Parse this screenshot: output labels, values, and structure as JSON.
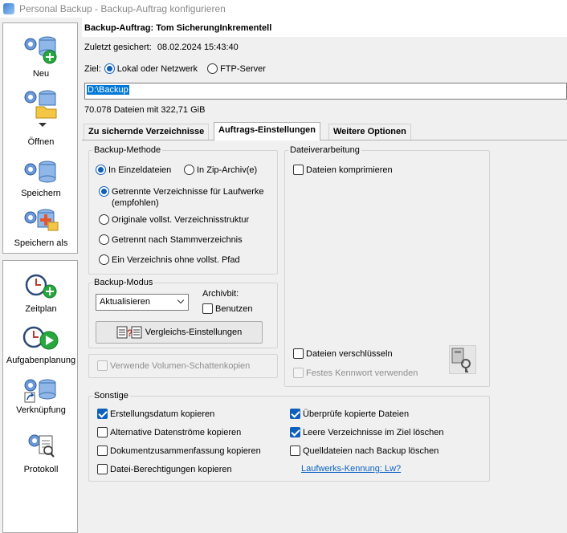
{
  "window": {
    "title": "Personal Backup - Backup-Auftrag konfigurieren"
  },
  "sidebar": {
    "top_items": [
      {
        "label": "Neu",
        "icon": "gears-database-plus-icon"
      },
      {
        "label": "Öffnen",
        "icon": "gears-database-folder-icon"
      },
      {
        "label": "Speichern",
        "icon": "gears-database-icon"
      },
      {
        "label": "Speichern als",
        "icon": "gears-database-save-as-icon"
      }
    ],
    "bottom_items": [
      {
        "label": "Zeitplan",
        "icon": "clock-plus-icon"
      },
      {
        "label": "Aufgabenplanung",
        "icon": "clock-play-icon"
      },
      {
        "label": "Verknüpfung",
        "icon": "shortcut-database-icon"
      },
      {
        "label": "Protokoll",
        "icon": "gear-document-icon"
      }
    ]
  },
  "header": {
    "title": "Backup-Auftrag: Tom SicherungInkrementell",
    "saved_label": "Zuletzt gesichert:",
    "saved_value": "08.02.2024 15:43:40"
  },
  "target": {
    "label": "Ziel:",
    "options": [
      "Lokal oder Netzwerk",
      "FTP-Server"
    ],
    "selected": "Lokal oder Netzwerk",
    "path": "D:\\Backup",
    "file_count": "70.078 Dateien mit 322,71 GiB"
  },
  "tabs": [
    "Zu sichernde Verzeichnisse",
    "Auftrags-Einstellungen",
    "Weitere Optionen"
  ],
  "active_tab": "Auftrags-Einstellungen",
  "backup_method": {
    "legend": "Backup-Methode",
    "mode_options": [
      "In Einzeldateien",
      "In Zip-Archiv(e)"
    ],
    "mode_selected": "In Einzeldateien",
    "structure_options": [
      "Getrennte Verzeichnisse für Laufwerke",
      "Originale vollst. Verzeichnisstruktur",
      "Getrennt nach Stammverzeichnis",
      "Ein Verzeichnis ohne vollst. Pfad"
    ],
    "structure_note": "(empfohlen)",
    "structure_selected": "Getrennte Verzeichnisse für Laufwerke"
  },
  "backup_mode": {
    "legend": "Backup-Modus",
    "select_value": "Aktualisieren",
    "archive_bit_label": "Archivbit:",
    "archive_bit_checkbox": "Benutzen",
    "archive_bit_checked": false,
    "compare_button": "Vergleichs-Einstellungen"
  },
  "shadow_copy": {
    "label": "Verwende Volumen-Schattenkopien",
    "checked": false,
    "enabled": false
  },
  "file_processing": {
    "legend": "Dateiverarbeitung",
    "compress": "Dateien komprimieren",
    "compress_checked": false,
    "encrypt": "Dateien verschlüsseln",
    "encrypt_checked": false,
    "fixed_password": "Festes Kennwort verwenden",
    "fixed_password_enabled": false,
    "key_icon": "key-computer-icon"
  },
  "other": {
    "legend": "Sonstige",
    "left": [
      {
        "label": "Erstellungsdatum kopieren",
        "checked": true
      },
      {
        "label": "Alternative Datenströme kopieren",
        "checked": false
      },
      {
        "label": "Dokumentzusammenfassung kopieren",
        "checked": false
      },
      {
        "label": "Datei-Berechtigungen kopieren",
        "checked": false
      }
    ],
    "right": [
      {
        "label": "Überprüfe kopierte Dateien",
        "checked": true
      },
      {
        "label": "Leere Verzeichnisse im Ziel löschen",
        "checked": true
      },
      {
        "label": "Quelldateien nach Backup löschen",
        "checked": false
      }
    ],
    "drive_link": "Laufwerks-Kennung: Lw?"
  },
  "colors": {
    "accent": "#0f5fbd",
    "selection": "#0078d7",
    "link": "#0b62c4"
  }
}
